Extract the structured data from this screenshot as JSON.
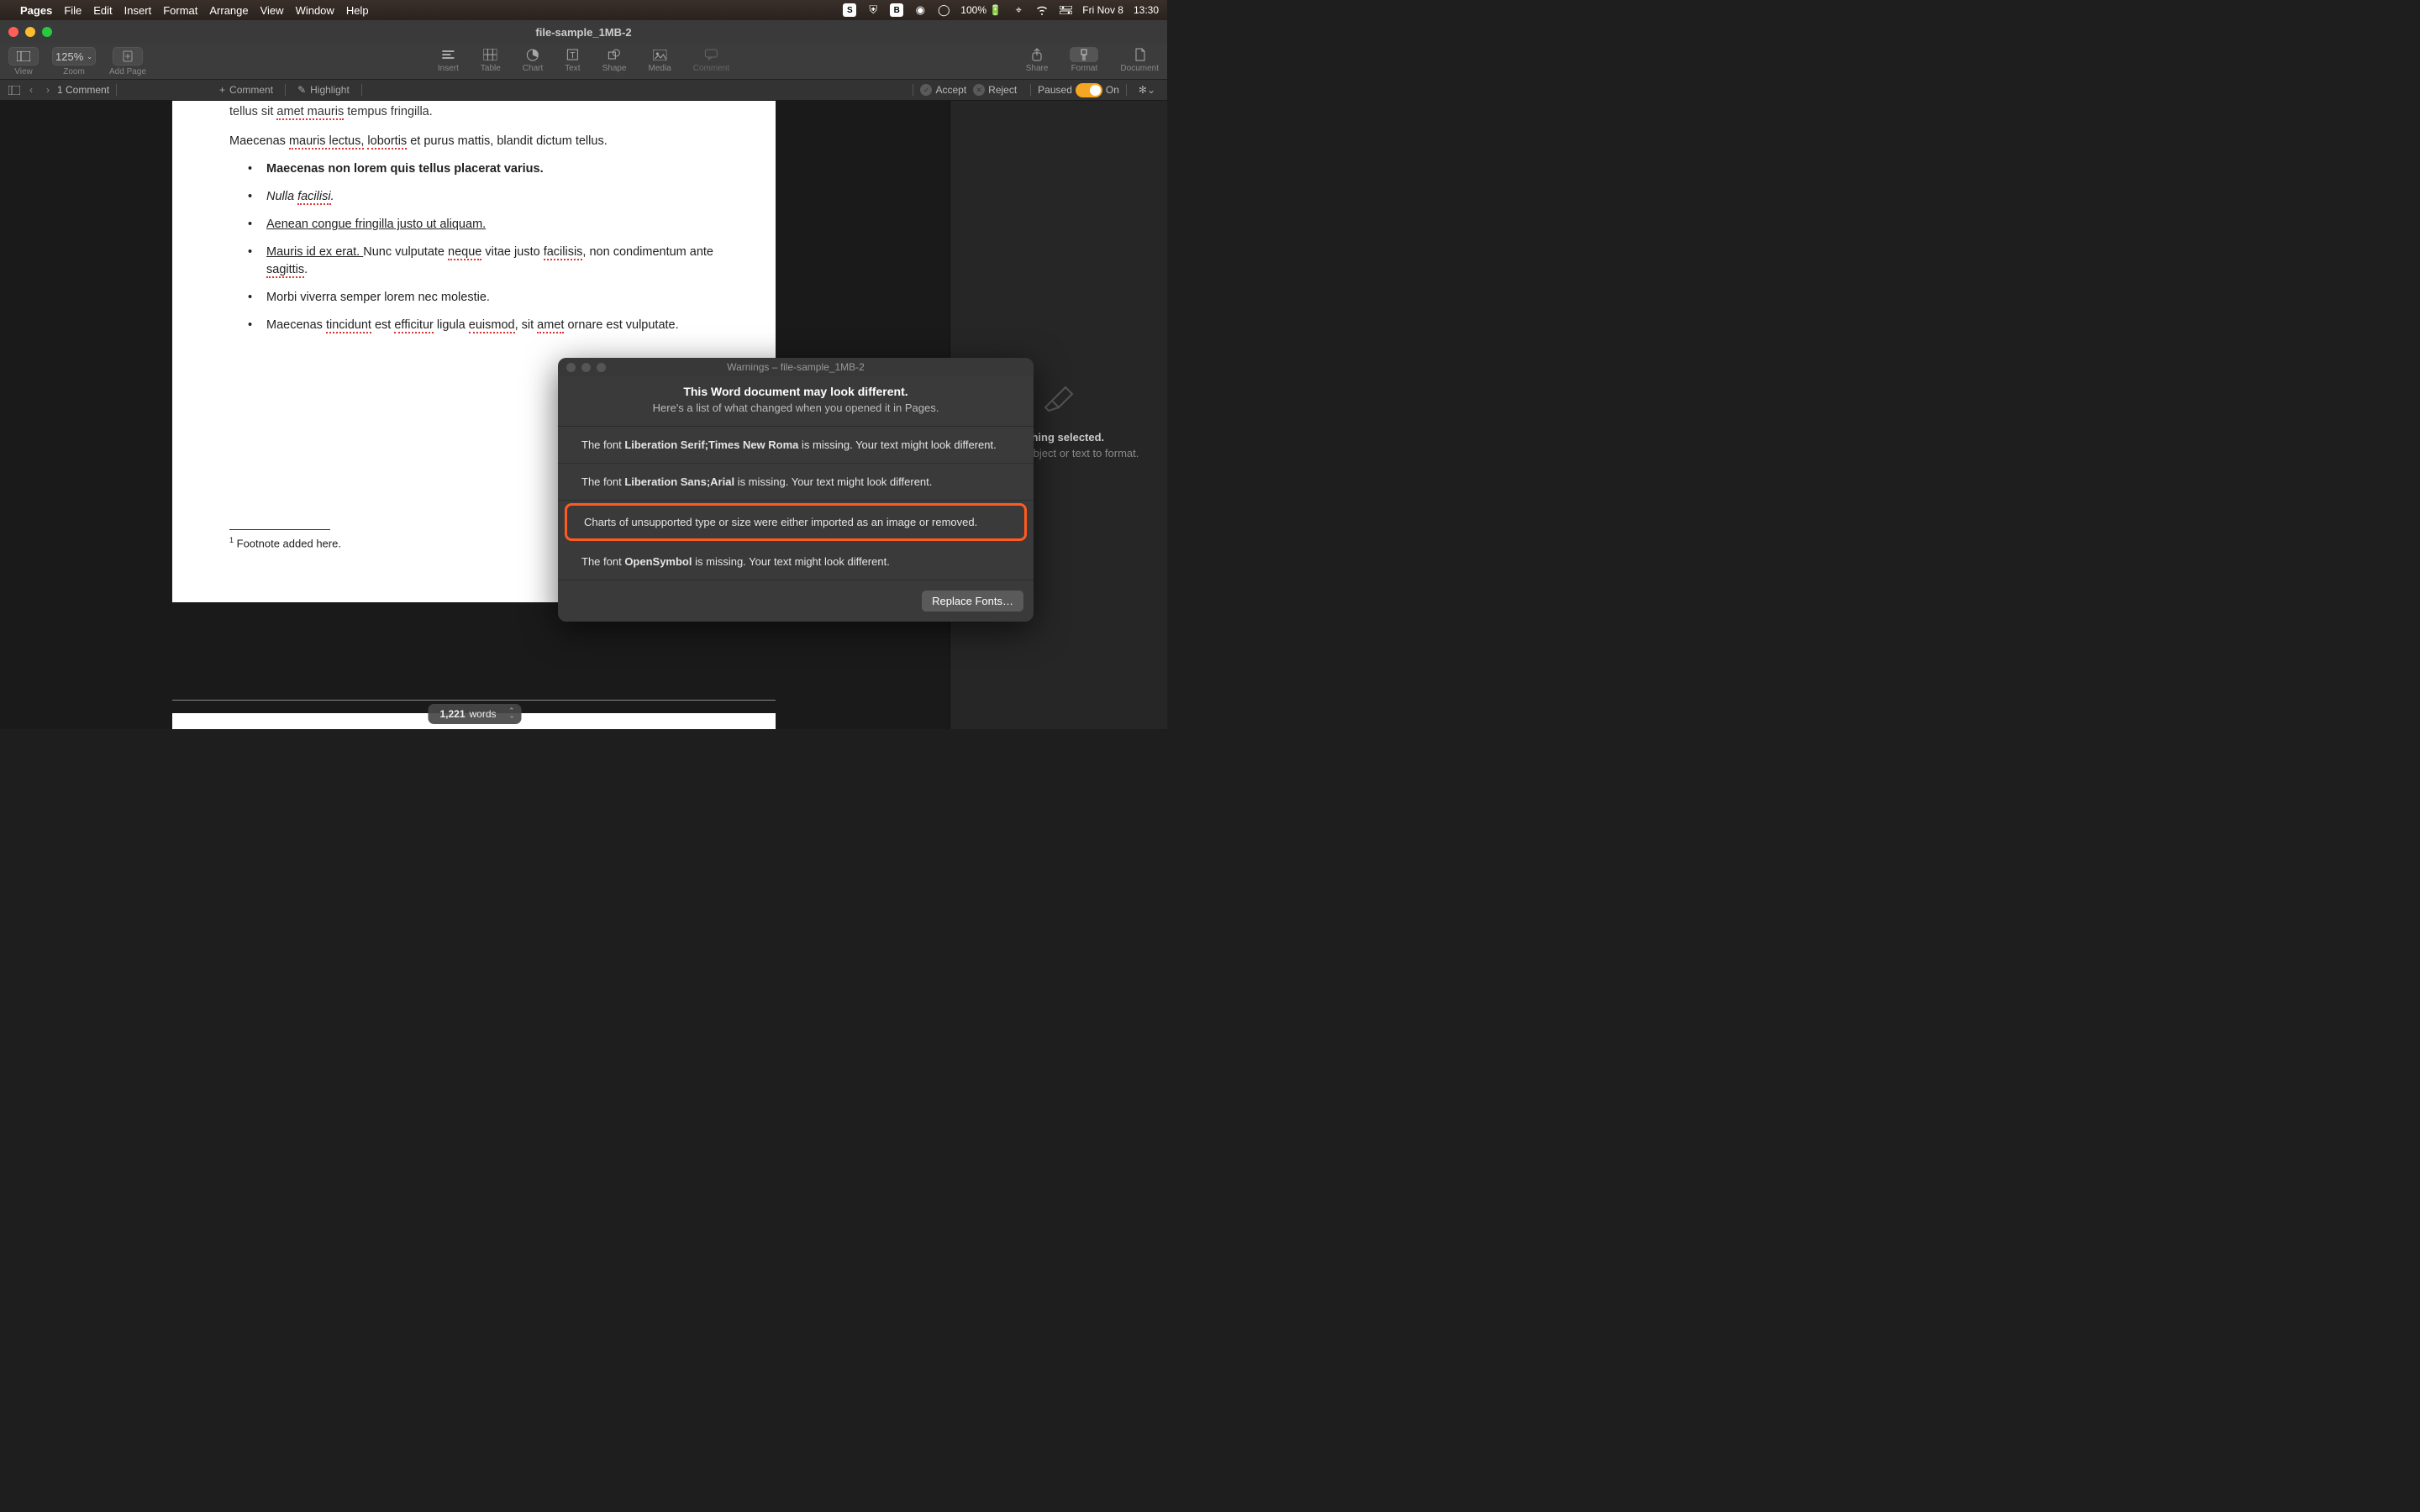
{
  "menubar": {
    "app": "Pages",
    "items": [
      "File",
      "Edit",
      "Insert",
      "Format",
      "Arrange",
      "View",
      "Window",
      "Help"
    ],
    "right": {
      "battery": "100%",
      "date": "Fri Nov 8",
      "time": "13:30"
    }
  },
  "window": {
    "title": "file-sample_1MB-2"
  },
  "toolbar": {
    "view": "View",
    "zoom_value": "125%",
    "zoom": "Zoom",
    "add_page": "Add Page",
    "insert": "Insert",
    "table": "Table",
    "chart": "Chart",
    "text": "Text",
    "shape": "Shape",
    "media": "Media",
    "comment": "Comment",
    "share": "Share",
    "format": "Format",
    "document": "Document"
  },
  "secbar": {
    "comment_count": "1 Comment",
    "comment": "Comment",
    "highlight": "Highlight",
    "accept": "Accept",
    "reject": "Reject",
    "paused": "Paused",
    "on": "On"
  },
  "doc": {
    "line1_a": "tellus sit ",
    "line1_b": "amet mauris",
    "line1_c": " tempus fringilla.",
    "line2_a": "Maecenas ",
    "line2_b": "mauris lectus,",
    "line2_c": " ",
    "line2_d": "lobortis",
    "line2_e": " et purus mattis, blandit dictum tellus.",
    "b1": "Maecenas non lorem quis tellus placerat varius.",
    "b2_a": "Nulla ",
    "b2_b": "facilisi",
    "b2_c": ".",
    "b3": "Aenean congue fringilla justo ut aliquam.",
    "b4_a": "Mauris id ex erat. ",
    "b4_b": "Nunc vulputate ",
    "b4_c": "neque",
    "b4_d": " vitae justo ",
    "b4_e": "facilisis",
    "b4_f": ", non condimentum ante ",
    "b4_g": "sagittis",
    "b4_h": ".",
    "b5": "Morbi viverra semper lorem nec molestie.",
    "b6_a": "Maecenas ",
    "b6_b": "tincidunt",
    "b6_c": " est ",
    "b6_d": "efficitur",
    "b6_e": " ligula ",
    "b6_f": "euismod",
    "b6_g": ", sit ",
    "b6_h": "amet",
    "b6_i": " ornare est vulputate.",
    "footnote_marker": "1",
    "footnote_text": " Footnote added here."
  },
  "rpanel": {
    "msg1": "Nothing selected.",
    "msg2": "Select an object or text to format."
  },
  "dialog": {
    "title": "Warnings – file-sample_1MB-2",
    "h1": "This Word document may look different.",
    "h2": "Here's a list of what changed when you opened it in Pages.",
    "rows": [
      {
        "pre": "The font ",
        "b": "Liberation Serif;Times New Roma",
        "post": " is missing. Your text might look different."
      },
      {
        "pre": "The font ",
        "b": "Liberation Sans;Arial",
        "post": " is missing. Your text might look different."
      },
      {
        "pre": "Charts of unsupported type or size were either imported as an image or removed.",
        "b": "",
        "post": ""
      },
      {
        "pre": "The font ",
        "b": "OpenSymbol",
        "post": " is missing. Your text might look different."
      }
    ],
    "button": "Replace Fonts…"
  },
  "wordcount": {
    "num": "1,221",
    "label": "words"
  }
}
